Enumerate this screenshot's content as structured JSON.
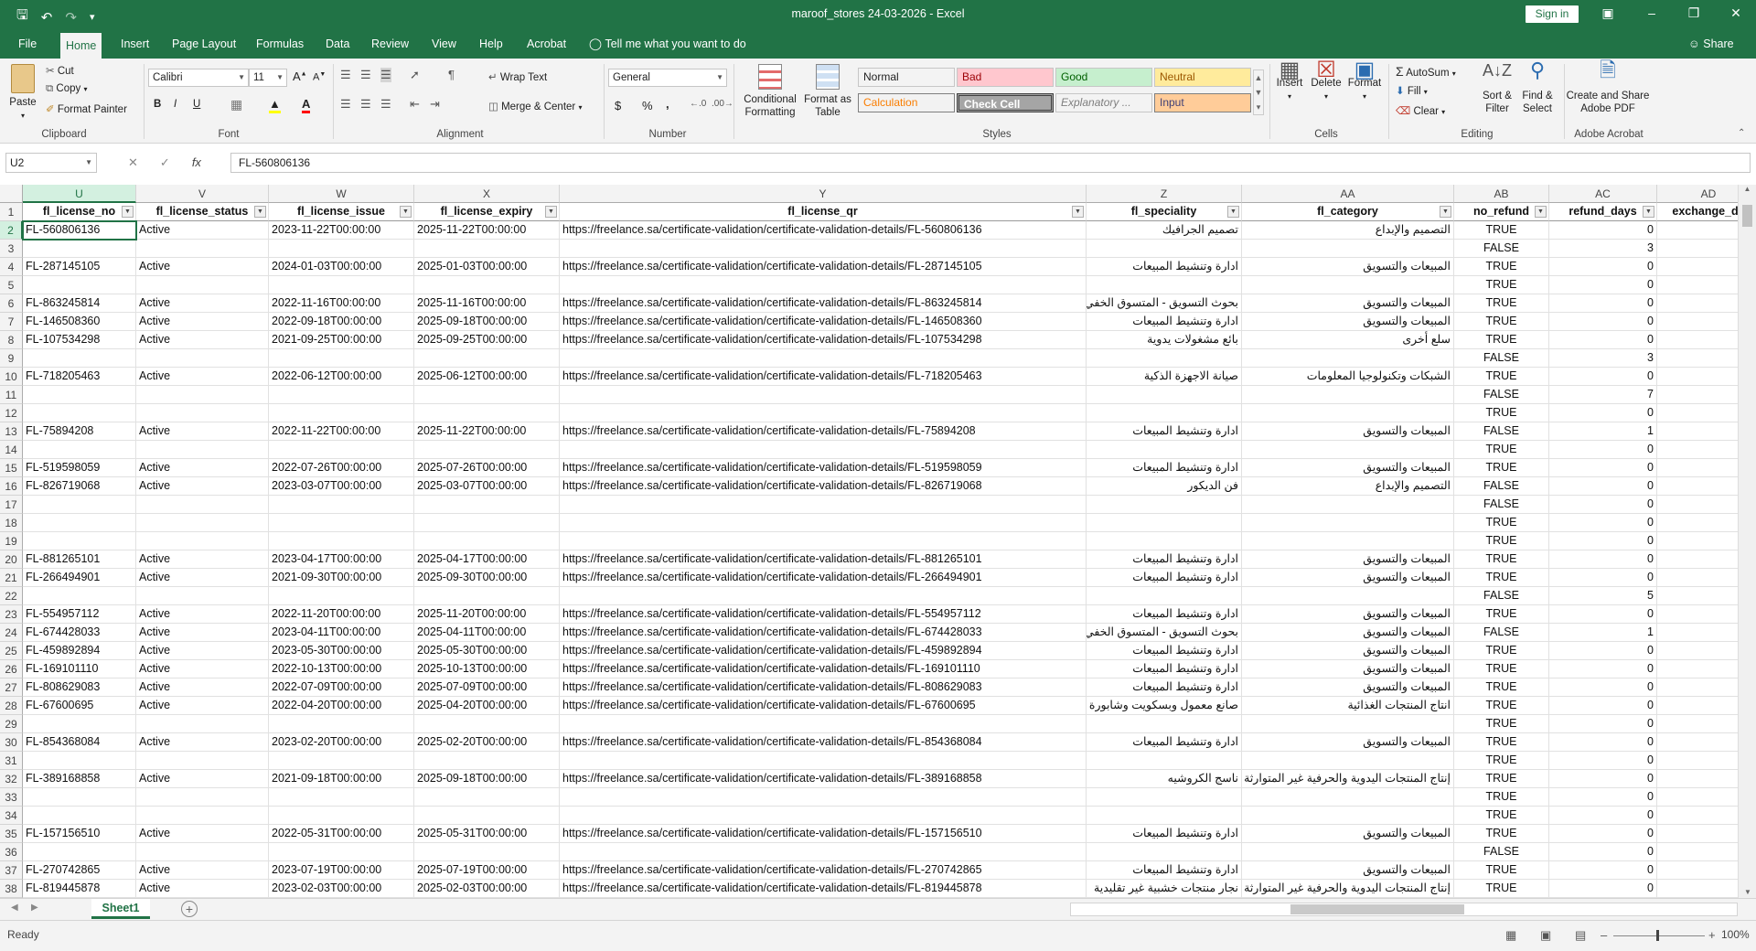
{
  "window": {
    "title": "maroof_stores 24-03-2026 - Excel",
    "sign_in": "Sign in",
    "share": "Share"
  },
  "tabs": [
    "File",
    "Home",
    "Insert",
    "Page Layout",
    "Formulas",
    "Data",
    "Review",
    "View",
    "Help",
    "Acrobat"
  ],
  "active_tab": "Home",
  "tell_me": "Tell me what you want to do",
  "ribbon": {
    "clipboard": {
      "label": "Clipboard",
      "paste": "Paste",
      "cut": "Cut",
      "copy": "Copy",
      "format_painter": "Format Painter"
    },
    "font": {
      "label": "Font",
      "name": "Calibri",
      "size": "11",
      "bold": "B",
      "italic": "I",
      "underline": "U"
    },
    "alignment": {
      "label": "Alignment",
      "wrap": "Wrap Text",
      "merge": "Merge & Center"
    },
    "number": {
      "label": "Number",
      "format": "General",
      "currency": "$",
      "percent": "%",
      "comma": ","
    },
    "styles": {
      "label": "Styles",
      "conditional": "Conditional Formatting",
      "format_table": "Format as Table",
      "cells": [
        {
          "name": "Normal",
          "bg": "#ffffff",
          "fg": "#000000"
        },
        {
          "name": "Bad",
          "bg": "#ffc7ce",
          "fg": "#9c0006"
        },
        {
          "name": "Good",
          "bg": "#c6efce",
          "fg": "#006100"
        },
        {
          "name": "Neutral",
          "bg": "#ffeb9c",
          "fg": "#9c5700"
        },
        {
          "name": "Calculation",
          "bg": "#f2f2f2",
          "fg": "#fa7d00"
        },
        {
          "name": "Check Cell",
          "bg": "#a5a5a5",
          "fg": "#ffffff"
        },
        {
          "name": "Explanatory ...",
          "bg": "#ffffff",
          "fg": "#7f7f7f"
        },
        {
          "name": "Input",
          "bg": "#ffcc99",
          "fg": "#3f3f76"
        }
      ]
    },
    "cells": {
      "label": "Cells",
      "insert": "Insert",
      "delete": "Delete",
      "format": "Format"
    },
    "editing": {
      "label": "Editing",
      "autosum": "AutoSum",
      "fill": "Fill",
      "clear": "Clear",
      "sort": "Sort & Filter",
      "find": "Find & Select"
    },
    "acrobat": {
      "label": "Adobe Acrobat",
      "create": "Create and Share Adobe PDF"
    }
  },
  "formula_bar": {
    "name_box": "U2",
    "formula": "FL-560806136"
  },
  "columns": [
    "U",
    "V",
    "W",
    "X",
    "Y",
    "Z",
    "AA",
    "AB",
    "AC",
    "AD"
  ],
  "selected_column": "U",
  "headers": [
    "fl_license_no",
    "fl_license_status",
    "fl_license_issue",
    "fl_license_expiry",
    "fl_license_qr",
    "fl_speciality",
    "fl_category",
    "no_refund",
    "refund_days",
    "exchange_da"
  ],
  "rows": [
    {
      "n": "2",
      "no": "FL-560806136",
      "status": "Active",
      "issue": "2023-11-22T00:00:00",
      "expiry": "2025-11-22T00:00:00",
      "qr": "https://freelance.sa/certificate-validation/certificate-validation-details/FL-560806136",
      "spec": "تصميم الجرافيك",
      "cat": "التصميم والإبداع",
      "refund": "TRUE",
      "days": "0"
    },
    {
      "n": "3",
      "no": "",
      "status": "",
      "issue": "",
      "expiry": "",
      "qr": "",
      "spec": "",
      "cat": "",
      "refund": "FALSE",
      "days": "3"
    },
    {
      "n": "4",
      "no": "FL-287145105",
      "status": "Active",
      "issue": "2024-01-03T00:00:00",
      "expiry": "2025-01-03T00:00:00",
      "qr": "https://freelance.sa/certificate-validation/certificate-validation-details/FL-287145105",
      "spec": "ادارة وتنشيط المبيعات",
      "cat": "المبيعات والتسويق",
      "refund": "TRUE",
      "days": "0"
    },
    {
      "n": "5",
      "no": "",
      "status": "",
      "issue": "",
      "expiry": "",
      "qr": "",
      "spec": "",
      "cat": "",
      "refund": "TRUE",
      "days": "0"
    },
    {
      "n": "6",
      "no": "FL-863245814",
      "status": "Active",
      "issue": "2022-11-16T00:00:00",
      "expiry": "2025-11-16T00:00:00",
      "qr": "https://freelance.sa/certificate-validation/certificate-validation-details/FL-863245814",
      "spec": "بحوث التسويق - المتسوق الخفي",
      "cat": "المبيعات والتسويق",
      "refund": "TRUE",
      "days": "0"
    },
    {
      "n": "7",
      "no": "FL-146508360",
      "status": "Active",
      "issue": "2022-09-18T00:00:00",
      "expiry": "2025-09-18T00:00:00",
      "qr": "https://freelance.sa/certificate-validation/certificate-validation-details/FL-146508360",
      "spec": "ادارة وتنشيط المبيعات",
      "cat": "المبيعات والتسويق",
      "refund": "TRUE",
      "days": "0"
    },
    {
      "n": "8",
      "no": "FL-107534298",
      "status": "Active",
      "issue": "2021-09-25T00:00:00",
      "expiry": "2025-09-25T00:00:00",
      "qr": "https://freelance.sa/certificate-validation/certificate-validation-details/FL-107534298",
      "spec": "بائع مشغولات يدوية",
      "cat": "سلع أخرى",
      "refund": "TRUE",
      "days": "0"
    },
    {
      "n": "9",
      "no": "",
      "status": "",
      "issue": "",
      "expiry": "",
      "qr": "",
      "spec": "",
      "cat": "",
      "refund": "FALSE",
      "days": "3"
    },
    {
      "n": "10",
      "no": "FL-718205463",
      "status": "Active",
      "issue": "2022-06-12T00:00:00",
      "expiry": "2025-06-12T00:00:00",
      "qr": "https://freelance.sa/certificate-validation/certificate-validation-details/FL-718205463",
      "spec": "صيانة الاجهزة الذكية",
      "cat": "الشبكات وتكنولوجيا المعلومات",
      "refund": "TRUE",
      "days": "0"
    },
    {
      "n": "11",
      "no": "",
      "status": "",
      "issue": "",
      "expiry": "",
      "qr": "",
      "spec": "",
      "cat": "",
      "refund": "FALSE",
      "days": "7"
    },
    {
      "n": "12",
      "no": "",
      "status": "",
      "issue": "",
      "expiry": "",
      "qr": "",
      "spec": "",
      "cat": "",
      "refund": "TRUE",
      "days": "0"
    },
    {
      "n": "13",
      "no": "FL-75894208",
      "status": "Active",
      "issue": "2022-11-22T00:00:00",
      "expiry": "2025-11-22T00:00:00",
      "qr": "https://freelance.sa/certificate-validation/certificate-validation-details/FL-75894208",
      "spec": "ادارة وتنشيط المبيعات",
      "cat": "المبيعات والتسويق",
      "refund": "FALSE",
      "days": "1"
    },
    {
      "n": "14",
      "no": "",
      "status": "",
      "issue": "",
      "expiry": "",
      "qr": "",
      "spec": "",
      "cat": "",
      "refund": "TRUE",
      "days": "0"
    },
    {
      "n": "15",
      "no": "FL-519598059",
      "status": "Active",
      "issue": "2022-07-26T00:00:00",
      "expiry": "2025-07-26T00:00:00",
      "qr": "https://freelance.sa/certificate-validation/certificate-validation-details/FL-519598059",
      "spec": "ادارة وتنشيط المبيعات",
      "cat": "المبيعات والتسويق",
      "refund": "TRUE",
      "days": "0"
    },
    {
      "n": "16",
      "no": "FL-826719068",
      "status": "Active",
      "issue": "2023-03-07T00:00:00",
      "expiry": "2025-03-07T00:00:00",
      "qr": "https://freelance.sa/certificate-validation/certificate-validation-details/FL-826719068",
      "spec": "فن الديكور",
      "cat": "التصميم والإبداع",
      "refund": "FALSE",
      "days": "0"
    },
    {
      "n": "17",
      "no": "",
      "status": "",
      "issue": "",
      "expiry": "",
      "qr": "",
      "spec": "",
      "cat": "",
      "refund": "FALSE",
      "days": "0"
    },
    {
      "n": "18",
      "no": "",
      "status": "",
      "issue": "",
      "expiry": "",
      "qr": "",
      "spec": "",
      "cat": "",
      "refund": "TRUE",
      "days": "0"
    },
    {
      "n": "19",
      "no": "",
      "status": "",
      "issue": "",
      "expiry": "",
      "qr": "",
      "spec": "",
      "cat": "",
      "refund": "TRUE",
      "days": "0"
    },
    {
      "n": "20",
      "no": "FL-881265101",
      "status": "Active",
      "issue": "2023-04-17T00:00:00",
      "expiry": "2025-04-17T00:00:00",
      "qr": "https://freelance.sa/certificate-validation/certificate-validation-details/FL-881265101",
      "spec": "ادارة وتنشيط المبيعات",
      "cat": "المبيعات والتسويق",
      "refund": "TRUE",
      "days": "0"
    },
    {
      "n": "21",
      "no": "FL-266494901",
      "status": "Active",
      "issue": "2021-09-30T00:00:00",
      "expiry": "2025-09-30T00:00:00",
      "qr": "https://freelance.sa/certificate-validation/certificate-validation-details/FL-266494901",
      "spec": "ادارة وتنشيط المبيعات",
      "cat": "المبيعات والتسويق",
      "refund": "TRUE",
      "days": "0"
    },
    {
      "n": "22",
      "no": "",
      "status": "",
      "issue": "",
      "expiry": "",
      "qr": "",
      "spec": "",
      "cat": "",
      "refund": "FALSE",
      "days": "5"
    },
    {
      "n": "23",
      "no": "FL-554957112",
      "status": "Active",
      "issue": "2022-11-20T00:00:00",
      "expiry": "2025-11-20T00:00:00",
      "qr": "https://freelance.sa/certificate-validation/certificate-validation-details/FL-554957112",
      "spec": "ادارة وتنشيط المبيعات",
      "cat": "المبيعات والتسويق",
      "refund": "TRUE",
      "days": "0"
    },
    {
      "n": "24",
      "no": "FL-674428033",
      "status": "Active",
      "issue": "2023-04-11T00:00:00",
      "expiry": "2025-04-11T00:00:00",
      "qr": "https://freelance.sa/certificate-validation/certificate-validation-details/FL-674428033",
      "spec": "بحوث التسويق - المتسوق الخفي",
      "cat": "المبيعات والتسويق",
      "refund": "FALSE",
      "days": "1"
    },
    {
      "n": "25",
      "no": "FL-459892894",
      "status": "Active",
      "issue": "2023-05-30T00:00:00",
      "expiry": "2025-05-30T00:00:00",
      "qr": "https://freelance.sa/certificate-validation/certificate-validation-details/FL-459892894",
      "spec": "ادارة وتنشيط المبيعات",
      "cat": "المبيعات والتسويق",
      "refund": "TRUE",
      "days": "0"
    },
    {
      "n": "26",
      "no": "FL-169101110",
      "status": "Active",
      "issue": "2022-10-13T00:00:00",
      "expiry": "2025-10-13T00:00:00",
      "qr": "https://freelance.sa/certificate-validation/certificate-validation-details/FL-169101110",
      "spec": "ادارة وتنشيط المبيعات",
      "cat": "المبيعات والتسويق",
      "refund": "TRUE",
      "days": "0"
    },
    {
      "n": "27",
      "no": "FL-808629083",
      "status": "Active",
      "issue": "2022-07-09T00:00:00",
      "expiry": "2025-07-09T00:00:00",
      "qr": "https://freelance.sa/certificate-validation/certificate-validation-details/FL-808629083",
      "spec": "ادارة وتنشيط المبيعات",
      "cat": "المبيعات والتسويق",
      "refund": "TRUE",
      "days": "0"
    },
    {
      "n": "28",
      "no": "FL-67600695",
      "status": "Active",
      "issue": "2022-04-20T00:00:00",
      "expiry": "2025-04-20T00:00:00",
      "qr": "https://freelance.sa/certificate-validation/certificate-validation-details/FL-67600695",
      "spec": "صانع معمول وبسكويت وشابورة",
      "cat": "انتاج المنتجات الغذائية",
      "refund": "TRUE",
      "days": "0"
    },
    {
      "n": "29",
      "no": "",
      "status": "",
      "issue": "",
      "expiry": "",
      "qr": "",
      "spec": "",
      "cat": "",
      "refund": "TRUE",
      "days": "0"
    },
    {
      "n": "30",
      "no": "FL-854368084",
      "status": "Active",
      "issue": "2023-02-20T00:00:00",
      "expiry": "2025-02-20T00:00:00",
      "qr": "https://freelance.sa/certificate-validation/certificate-validation-details/FL-854368084",
      "spec": "ادارة وتنشيط المبيعات",
      "cat": "المبيعات والتسويق",
      "refund": "TRUE",
      "days": "0"
    },
    {
      "n": "31",
      "no": "",
      "status": "",
      "issue": "",
      "expiry": "",
      "qr": "",
      "spec": "",
      "cat": "",
      "refund": "TRUE",
      "days": "0"
    },
    {
      "n": "32",
      "no": "FL-389168858",
      "status": "Active",
      "issue": "2021-09-18T00:00:00",
      "expiry": "2025-09-18T00:00:00",
      "qr": "https://freelance.sa/certificate-validation/certificate-validation-details/FL-389168858",
      "spec": "ناسج الكروشيه",
      "cat": "إنتاج المنتجات اليدوية والحرفية غير المتوارثة",
      "refund": "TRUE",
      "days": "0"
    },
    {
      "n": "33",
      "no": "",
      "status": "",
      "issue": "",
      "expiry": "",
      "qr": "",
      "spec": "",
      "cat": "",
      "refund": "TRUE",
      "days": "0"
    },
    {
      "n": "34",
      "no": "",
      "status": "",
      "issue": "",
      "expiry": "",
      "qr": "",
      "spec": "",
      "cat": "",
      "refund": "TRUE",
      "days": "0"
    },
    {
      "n": "35",
      "no": "FL-157156510",
      "status": "Active",
      "issue": "2022-05-31T00:00:00",
      "expiry": "2025-05-31T00:00:00",
      "qr": "https://freelance.sa/certificate-validation/certificate-validation-details/FL-157156510",
      "spec": "ادارة وتنشيط المبيعات",
      "cat": "المبيعات والتسويق",
      "refund": "TRUE",
      "days": "0"
    },
    {
      "n": "36",
      "no": "",
      "status": "",
      "issue": "",
      "expiry": "",
      "qr": "",
      "spec": "",
      "cat": "",
      "refund": "FALSE",
      "days": "0"
    },
    {
      "n": "37",
      "no": "FL-270742865",
      "status": "Active",
      "issue": "2023-07-19T00:00:00",
      "expiry": "2025-07-19T00:00:00",
      "qr": "https://freelance.sa/certificate-validation/certificate-validation-details/FL-270742865",
      "spec": "ادارة وتنشيط المبيعات",
      "cat": "المبيعات والتسويق",
      "refund": "TRUE",
      "days": "0"
    },
    {
      "n": "38",
      "no": "FL-819445878",
      "status": "Active",
      "issue": "2023-02-03T00:00:00",
      "expiry": "2025-02-03T00:00:00",
      "qr": "https://freelance.sa/certificate-validation/certificate-validation-details/FL-819445878",
      "spec": "نجار منتجات خشبية غير تقليدية",
      "cat": "إنتاج المنتجات اليدوية والحرفية غير المتوارثة",
      "refund": "TRUE",
      "days": "0"
    }
  ],
  "sheet_tab": "Sheet1",
  "status": {
    "ready": "Ready",
    "zoom": "100%"
  },
  "colors": {
    "accent": "#217346"
  }
}
